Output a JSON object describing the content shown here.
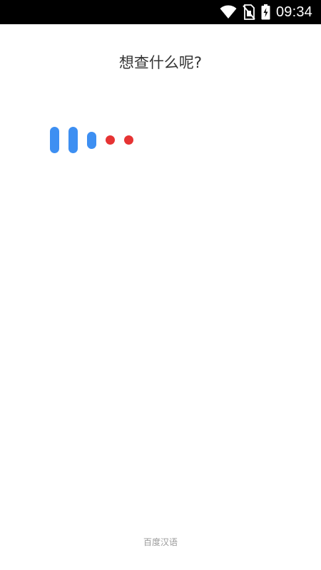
{
  "status_bar": {
    "time": "09:34",
    "icons": [
      "wifi-icon",
      "no-sim-icon",
      "battery-charging-icon"
    ],
    "background": "#000000",
    "foreground": "#ffffff"
  },
  "prompt": {
    "title": "想查什么呢?"
  },
  "voice_indicator": {
    "state": "listening",
    "bar_color": "#3d8ff2",
    "dot_color": "#e63333"
  },
  "footer": {
    "brand": "百度汉语"
  }
}
